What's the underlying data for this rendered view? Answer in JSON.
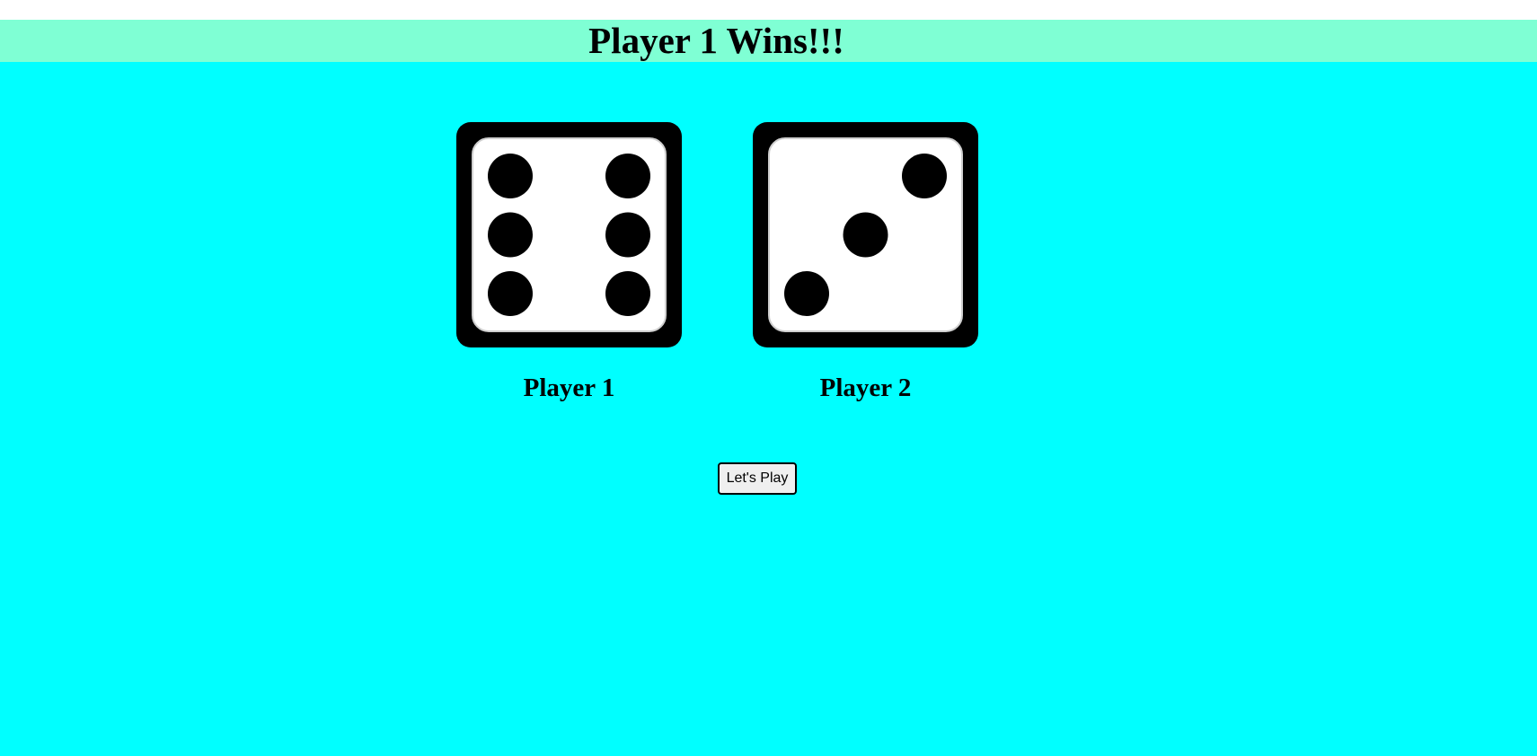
{
  "banner": {
    "title": "Player 1 Wins!!!"
  },
  "players": [
    {
      "label": "Player 1",
      "die_value": 6,
      "die_icon": "dice-six-icon"
    },
    {
      "label": "Player 2",
      "die_value": 3,
      "die_icon": "dice-three-icon"
    }
  ],
  "controls": {
    "play_label": "Let's Play"
  },
  "colors": {
    "page_background": "#00ffff",
    "banner_background": "#7fffd4",
    "die_frame": "#000000",
    "die_face": "#ffffff",
    "pip": "#000000"
  }
}
